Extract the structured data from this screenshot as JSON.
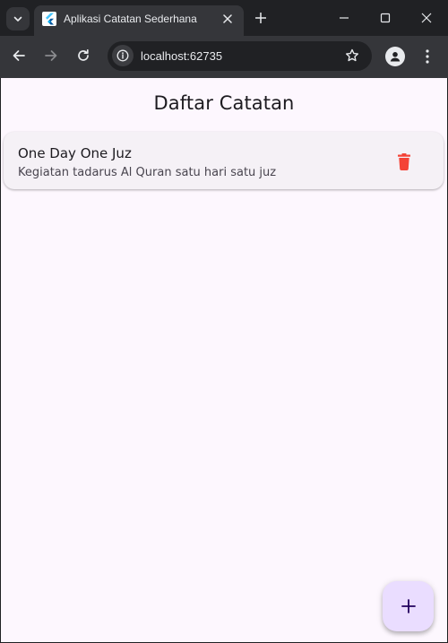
{
  "browser": {
    "tab": {
      "title": "Aplikasi Catatan Sederhana",
      "favicon": "flutter-icon"
    },
    "url": "localhost:62735",
    "icons": {
      "tab_search": "chevron-down-icon",
      "tab_close": "close-icon",
      "new_tab": "plus-icon",
      "minimize": "minimize-icon",
      "maximize": "maximize-icon",
      "close_window": "close-icon",
      "back": "arrow-left-icon",
      "forward": "arrow-right-icon",
      "reload": "reload-icon",
      "site_info": "info-icon",
      "bookmark": "star-icon",
      "profile": "person-icon",
      "menu": "more-vert-icon"
    },
    "colors": {
      "frame": "#202124",
      "toolbar": "#35363a",
      "text": "#e8eaed"
    }
  },
  "app": {
    "title": "Daftar Catatan",
    "notes": [
      {
        "title": "One Day One Juz",
        "description": "Kegiatan tadarus Al Quran satu hari satu juz",
        "action_icon": "trash-icon"
      }
    ],
    "fab_icon": "plus-icon",
    "colors": {
      "background": "#fdf7fe",
      "card": "#f5f1f6",
      "delete": "#f44336",
      "fab": "#eaddff",
      "fab_icon": "#21005d"
    }
  }
}
